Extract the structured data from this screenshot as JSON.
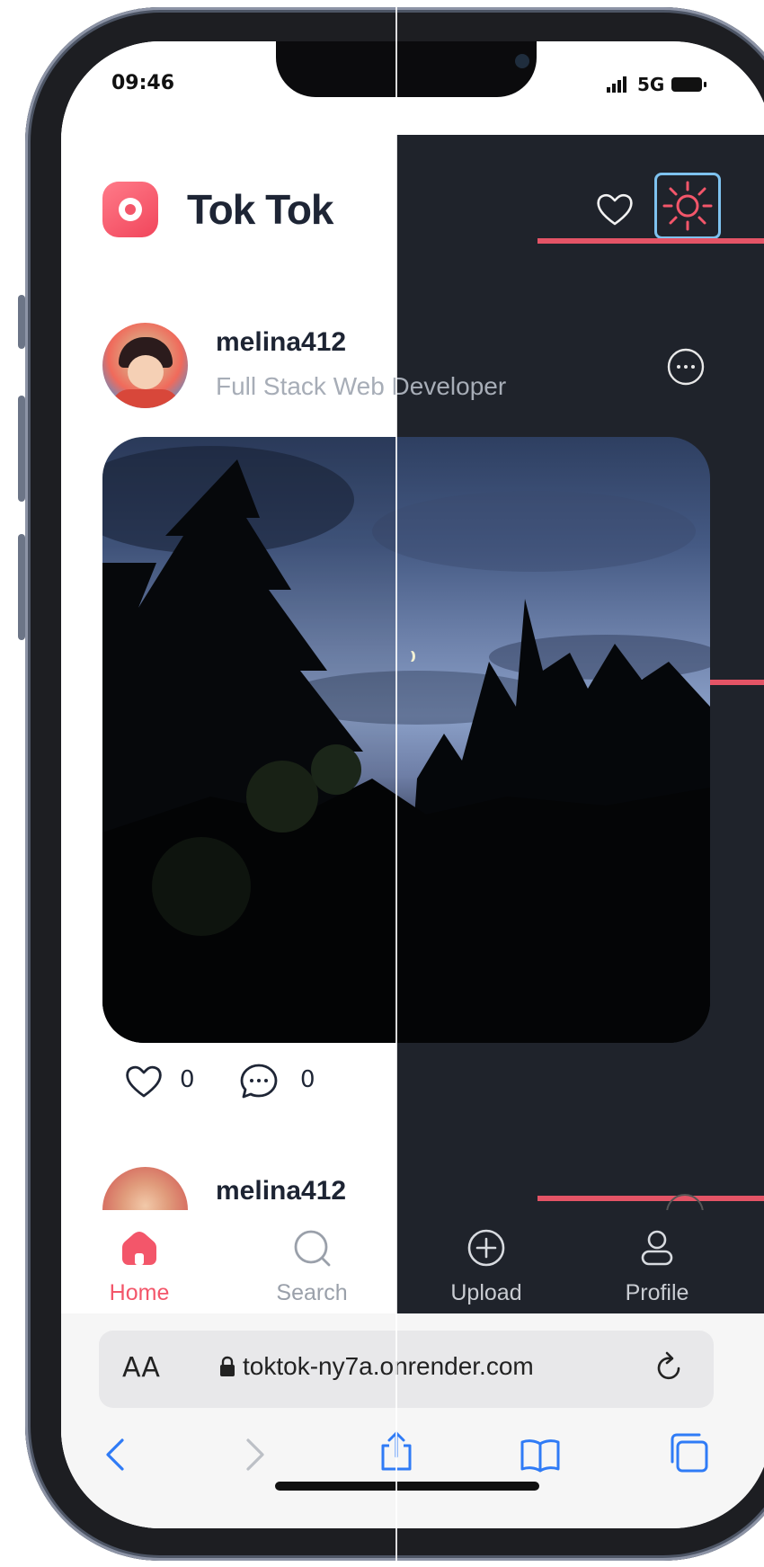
{
  "status_bar": {
    "time": "09:46",
    "network": "5G"
  },
  "header": {
    "app_title": "Tok Tok"
  },
  "post": {
    "username": "melina412",
    "subtitle": "Full Stack Web Developer",
    "likes": "0",
    "comments": "0"
  },
  "next_post": {
    "username": "melina412"
  },
  "nav": {
    "items": [
      {
        "label": "Home",
        "active": true
      },
      {
        "label": "Search",
        "active": false
      },
      {
        "label": "Upload",
        "active": false
      },
      {
        "label": "Profile",
        "active": false
      }
    ]
  },
  "browser": {
    "text_size_label": "AA",
    "url": "toktok-ny7a.onrender.com"
  },
  "colors": {
    "accent": "#f3566a",
    "dark_bg": "#1f232b",
    "theme_btn_border": "#7ec2ef",
    "ios_blue": "#2f7bf6"
  }
}
